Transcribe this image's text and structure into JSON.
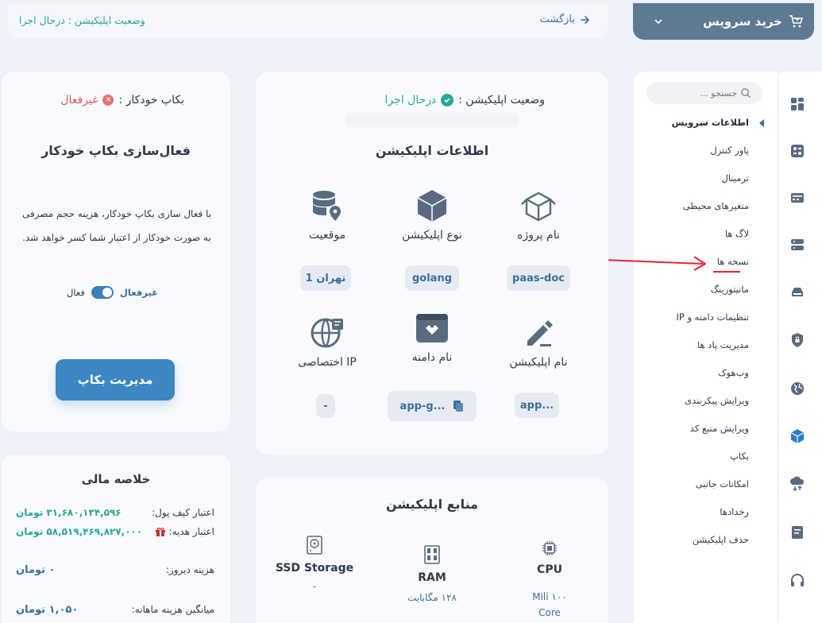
{
  "topbar": {
    "status_text": "وضعیت اپلیکیشن : درحال اجرا",
    "back_label": "بازگشت"
  },
  "buy_service": {
    "label": "خرید سرویس"
  },
  "menu": {
    "search_placeholder": "جستجو ...",
    "items": [
      {
        "label": "اطلاعات سرویس"
      },
      {
        "label": "پاور کنترل"
      },
      {
        "label": "ترمینال"
      },
      {
        "label": "متغیرهای محیطی"
      },
      {
        "label": "لاگ ها"
      },
      {
        "label": "نسخه ها"
      },
      {
        "label": "مانیتورینگ"
      },
      {
        "label": "تنظیمات دامنه و IP"
      },
      {
        "label": "مدیریت پاد ها"
      },
      {
        "label": "وب‌هوک"
      },
      {
        "label": "ویرایش پیکربندی"
      },
      {
        "label": "ویرایش منبع کد"
      },
      {
        "label": "بکاپ"
      },
      {
        "label": "امکانات جانبی"
      },
      {
        "label": "رخدادها"
      },
      {
        "label": "حذف اپلیکیشن"
      }
    ]
  },
  "app_card": {
    "status_label": "وضعیت اپلیکیشن :",
    "status_value": "درحال اجرا",
    "title": "اطلاعات اپلیکیشن",
    "project_name_label": "نام پروژه",
    "project_name_value": "paas-doc",
    "app_type_label": "نوع اپلیکیشن",
    "app_type_value": "golang",
    "location_label": "موقعیت",
    "location_value": "تهران 1",
    "app_name_label": "نام اپلیکیشن",
    "app_name_value": "app...",
    "domain_label": "نام دامنه",
    "domain_value": "app-g...",
    "ip_label": "IP اختصاصی",
    "ip_value": "-"
  },
  "resources": {
    "title": "منابع اپلیکیشن",
    "cpu_label": "CPU",
    "cpu_value": "۱۰۰ Mili Core",
    "ram_label": "RAM",
    "ram_value": "۱۲۸ مگابایت",
    "ssd_label": "SSD Storage",
    "ssd_value": "-"
  },
  "backup": {
    "auto_label": "بکاپ خودکار :",
    "auto_value": "غیرفعال",
    "title": "فعال‌سازی بکاپ خودکار",
    "description": "با فعال سازی بکاپ خودکار، هزینه حجم مصرفی به صورت خودکار از اعتبار شما کسر خواهد شد.",
    "toggle_off": "غیرفعال",
    "toggle_on": "فعال",
    "manage_button": "مدیریت بکاپ"
  },
  "finance": {
    "title": "خلاصه مالی",
    "wallet_label": "اعتبار کیف پول:",
    "wallet_value": "۳۱,۶۸۰,۱۳۴,۵۹۶ تومان",
    "gift_label": "اعتبار هدیه:",
    "gift_value": "۵۸,۵۱۹,۴۶۹,۸۲۷,۰۰۰ تومان",
    "yesterday_label": "هزینه دیروز:",
    "yesterday_value": "۰ تومان",
    "monthly_label": "میانگین هزینه ماهانه:",
    "monthly_value": "۱,۰۵۰ تومان"
  },
  "colors": {
    "accent": "#3a87c2",
    "success": "#2aa59a",
    "danger": "#e05a5a",
    "annotation": "#e32636"
  }
}
